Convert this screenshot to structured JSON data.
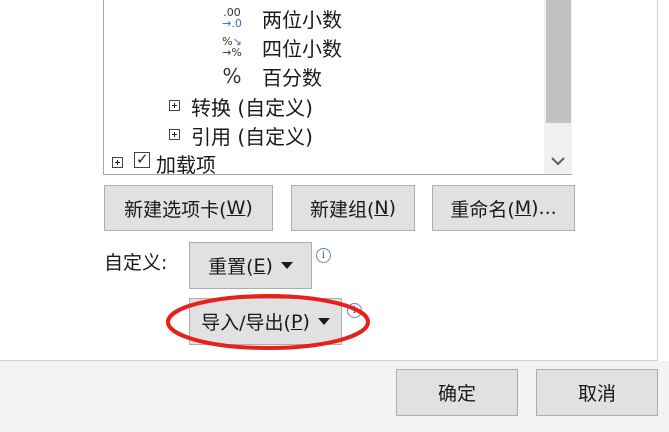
{
  "tree": {
    "items": [
      {
        "icon": ".00\n→.0",
        "label": "两位小数"
      },
      {
        "icon": "%→",
        "label": "四位小数"
      },
      {
        "icon": "%",
        "label": "百分数"
      },
      {
        "label": "转换 (自定义)"
      },
      {
        "label": "引用 (自定义)"
      },
      {
        "label": "加载项"
      }
    ]
  },
  "buttons": {
    "new_tab": {
      "label": "新建选项卡(",
      "key": "W",
      "tail": ")"
    },
    "new_group": {
      "label": "新建组(",
      "key": "N",
      "tail": ")"
    },
    "rename": {
      "label": "重命名(",
      "key": "M",
      "tail": ")..."
    },
    "reset": {
      "label": "重置(",
      "key": "E",
      "tail": ")"
    },
    "import_export": {
      "label": "导入/导出(",
      "key": "P",
      "tail": ")"
    },
    "ok": "确定",
    "cancel": "取消"
  },
  "customize_label": "自定义:",
  "info_glyph": "i",
  "colors": {
    "highlight_ellipse": "#e8201a",
    "button_bg": "#e1e1e1",
    "info_blue": "#3a5fb0"
  }
}
